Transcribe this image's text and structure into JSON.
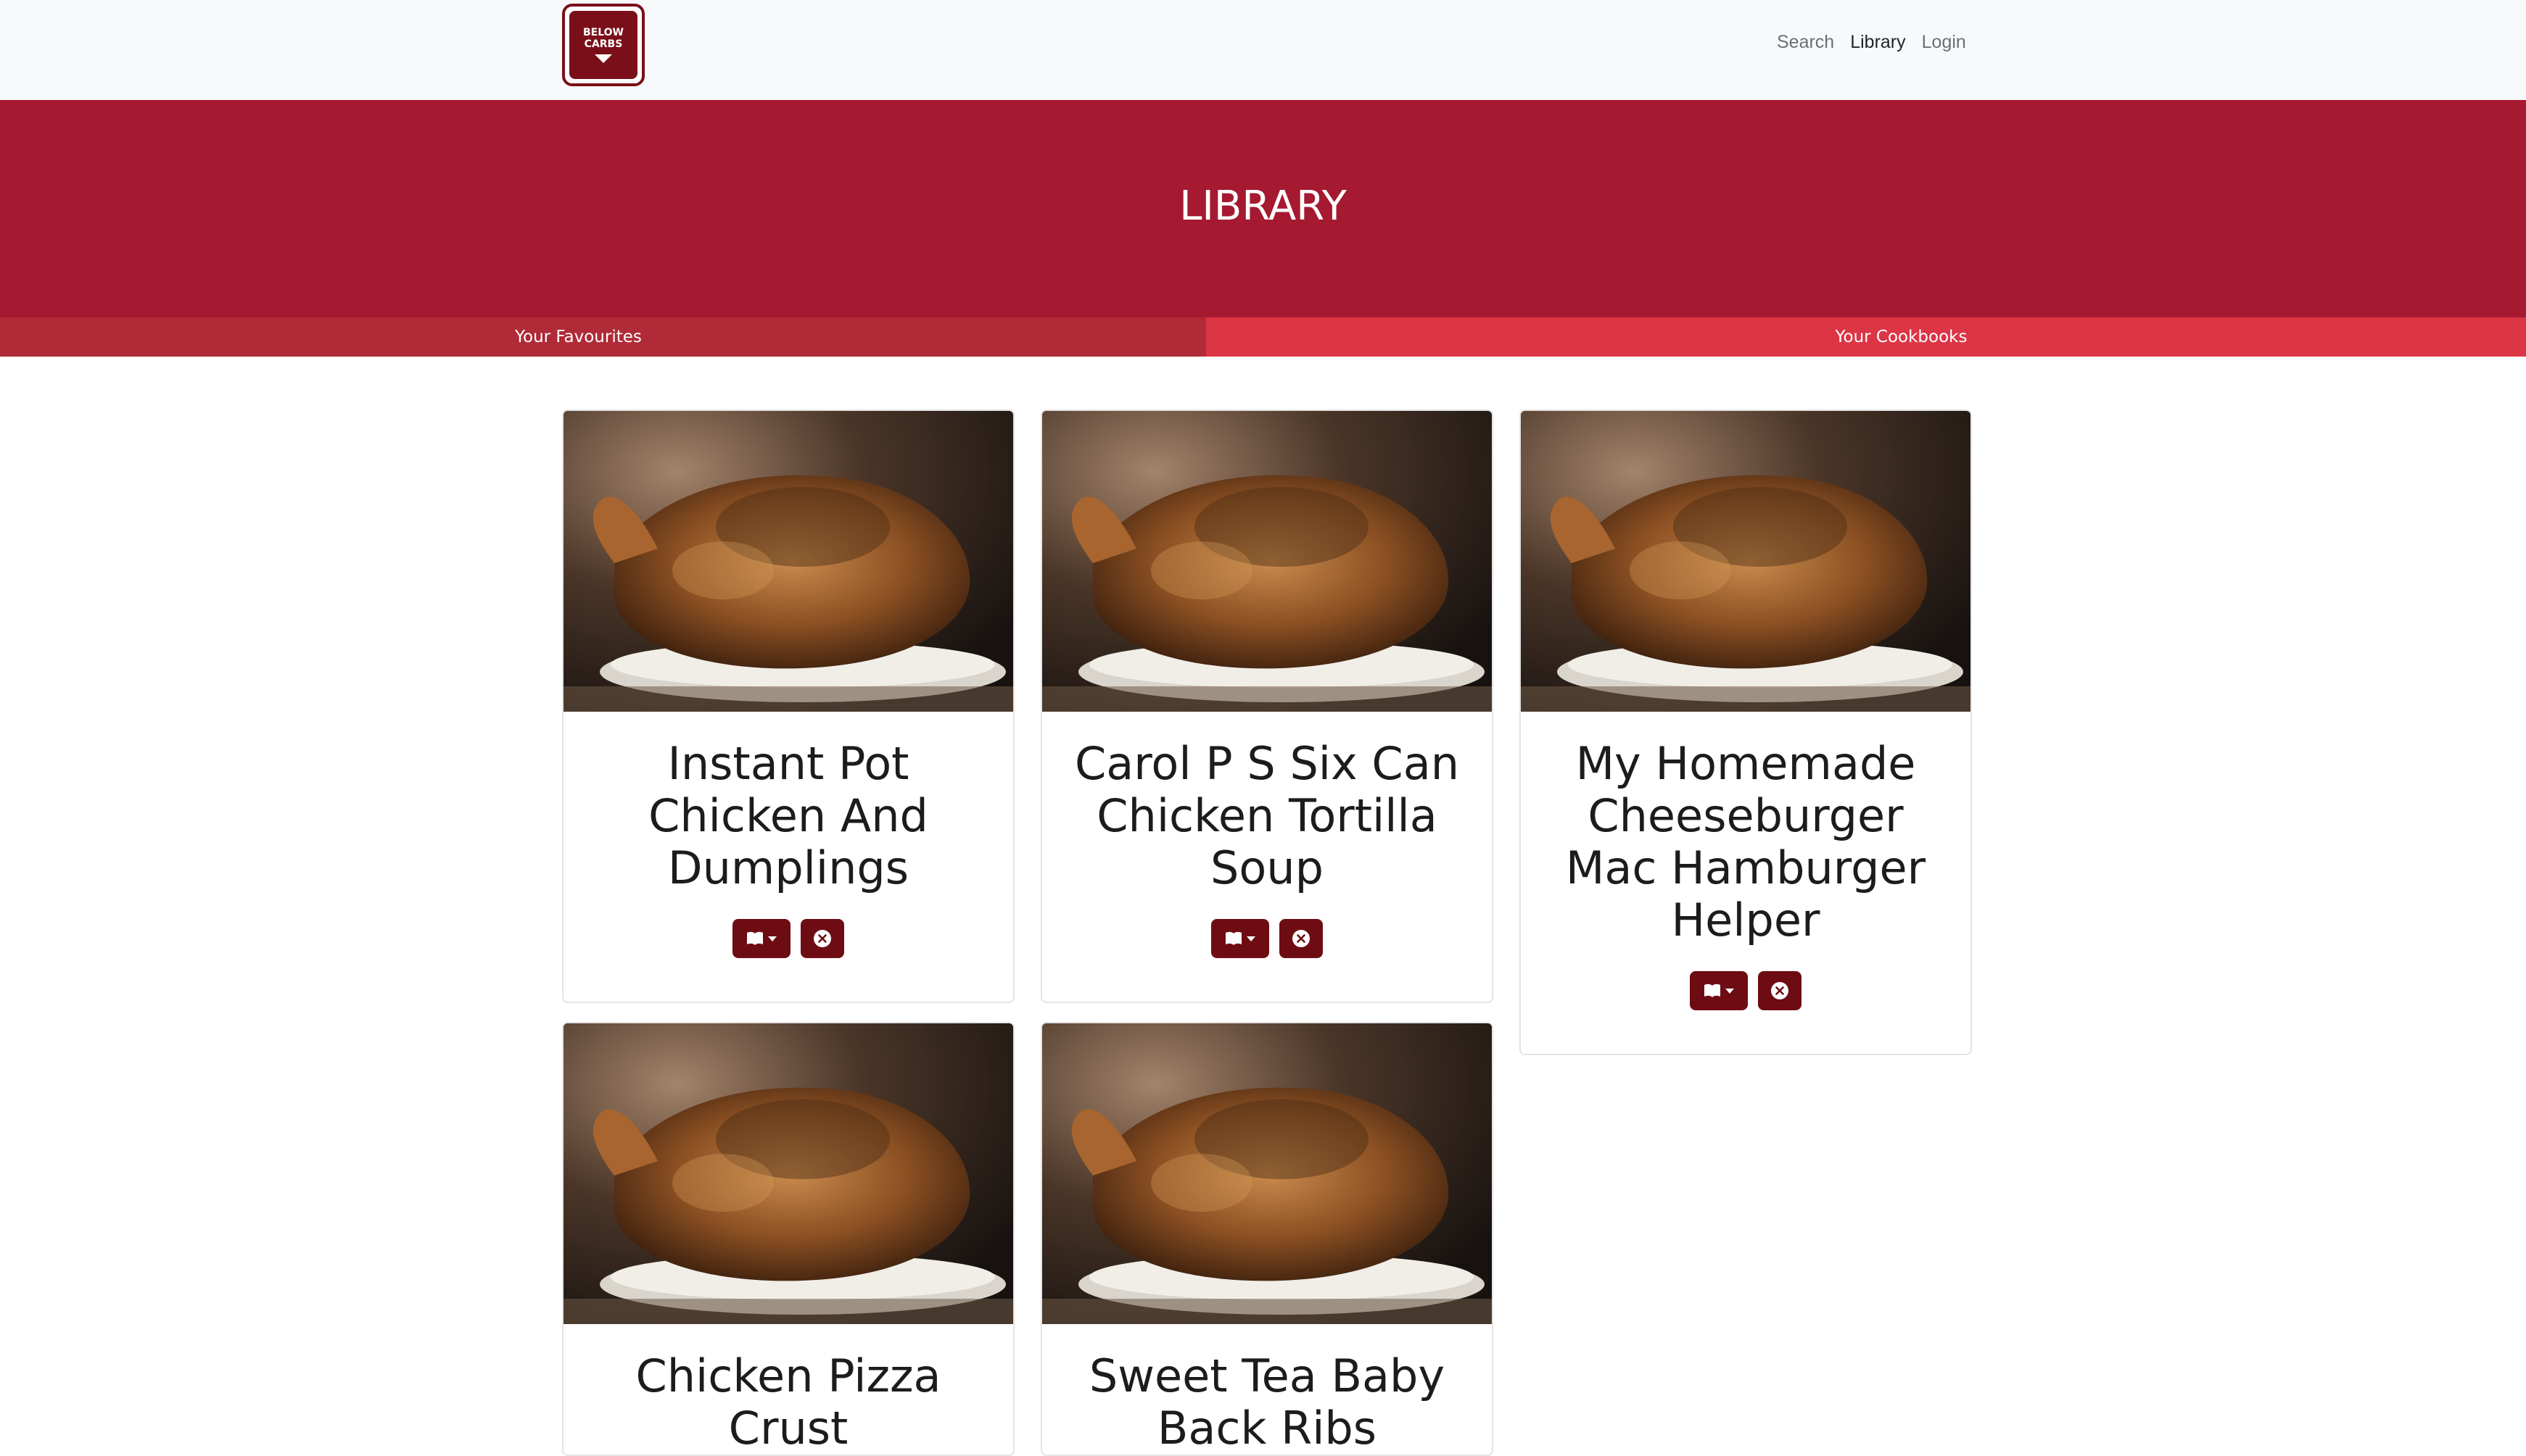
{
  "brand": {
    "logo_line1": "BELOW",
    "logo_line2": "CARBS"
  },
  "nav": {
    "search": "Search",
    "library": "Library",
    "login": "Login"
  },
  "hero": {
    "title": "LIBRARY"
  },
  "tabs": {
    "favourites": "Your Favourites",
    "cookbooks": "Your Cookbooks"
  },
  "icons": {
    "cookbook": "book-dropdown-icon",
    "remove": "close-circle-icon"
  },
  "colors": {
    "brand_dark": "#7a0f19",
    "hero_red": "#a51931",
    "tab_favourites": "#b02a37",
    "tab_cookbooks": "#dc3545",
    "button": "#6e0c14"
  },
  "recipes": [
    {
      "title": "Instant Pot Chicken And Dumplings"
    },
    {
      "title": "Carol P S Six Can Chicken Tortilla Soup"
    },
    {
      "title": "My Homemade Cheeseburger Mac Hamburger Helper"
    },
    {
      "title": "Chicken Pizza Crust"
    },
    {
      "title": "Sweet Tea Baby Back Ribs"
    }
  ]
}
